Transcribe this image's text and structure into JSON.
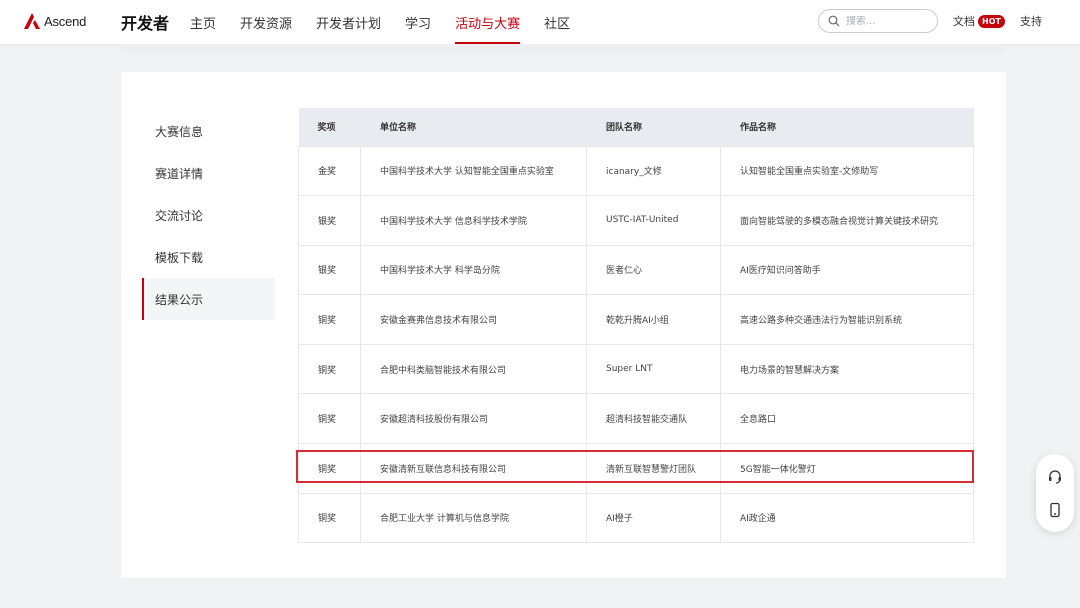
{
  "header": {
    "logo_text": "Ascend",
    "brand": "开发者",
    "nav": [
      {
        "label": "主页",
        "active": false
      },
      {
        "label": "开发资源",
        "active": false
      },
      {
        "label": "开发者计划",
        "active": false
      },
      {
        "label": "学习",
        "active": false
      },
      {
        "label": "活动与大赛",
        "active": true
      },
      {
        "label": "社区",
        "active": false
      }
    ],
    "search_placeholder": "搜索...",
    "docs_label": "文档",
    "hot_badge": "HOT",
    "support_label": "支持"
  },
  "sidebar": {
    "items": [
      {
        "label": "大赛信息",
        "active": false
      },
      {
        "label": "赛道详情",
        "active": false
      },
      {
        "label": "交流讨论",
        "active": false
      },
      {
        "label": "模板下载",
        "active": false
      },
      {
        "label": "结果公示",
        "active": true
      }
    ]
  },
  "table": {
    "columns": [
      "奖项",
      "单位名称",
      "团队名称",
      "作品名称"
    ],
    "rows": [
      {
        "award": "金奖",
        "org": "中国科学技术大学 认知智能全国重点实验室",
        "team": "icanary_文修",
        "work": "认知智能全国重点实验室-文修助写"
      },
      {
        "award": "银奖",
        "org": "中国科学技术大学 信息科学技术学院",
        "team": "USTC-IAT-United",
        "work": "面向智能驾驶的多模态融合视觉计算关键技术研究"
      },
      {
        "award": "银奖",
        "org": "中国科学技术大学 科学岛分院",
        "team": "医者仁心",
        "work": "AI医疗知识问答助手"
      },
      {
        "award": "铜奖",
        "org": "安徽金赛弗信息技术有限公司",
        "team": "乾乾升腾AI小组",
        "work": "高速公路多种交通违法行为智能识别系统"
      },
      {
        "award": "铜奖",
        "org": "合肥中科类脑智能技术有限公司",
        "team": "Super LNT",
        "work": "电力场景的智慧解决方案"
      },
      {
        "award": "铜奖",
        "org": "安徽超清科技股份有限公司",
        "team": "超清科技智能交通队",
        "work": "全息路口"
      },
      {
        "award": "铜奖",
        "org": "安徽清新互联信息科技有限公司",
        "team": "清新互联智慧警灯团队",
        "work": "5G智能一体化警灯"
      },
      {
        "award": "铜奖",
        "org": "合肥工业大学 计算机与信息学院",
        "team": "AI橙子",
        "work": "AI政企通"
      }
    ]
  },
  "colors": {
    "accent": "#c7000b",
    "highlight_border": "#d62c36",
    "table_header_bg": "#e8ebf0"
  },
  "icons": {
    "logo": "ascend-logo-icon",
    "search": "search-icon",
    "service": "customer-service-icon",
    "mobile": "mobile-phone-icon"
  }
}
